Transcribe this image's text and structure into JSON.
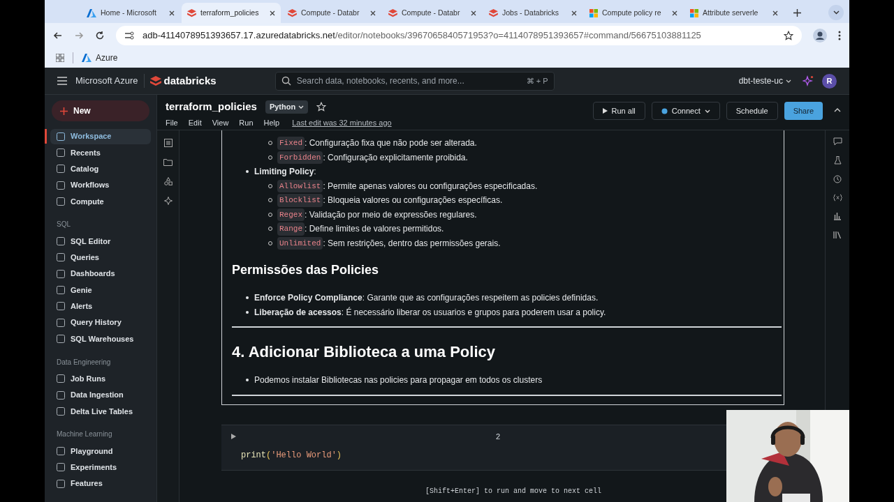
{
  "browser": {
    "tabs": [
      {
        "title": "Home - Microsoft",
        "selected": false
      },
      {
        "title": "terraform_policies",
        "selected": true
      },
      {
        "title": "Compute - Databr",
        "selected": false
      },
      {
        "title": "Compute - Databr",
        "selected": false
      },
      {
        "title": "Jobs - Databricks",
        "selected": false
      },
      {
        "title": "Compute policy re",
        "selected": false
      },
      {
        "title": "Attribute serverle",
        "selected": false
      }
    ],
    "url_host": "adb-4114078951393657.17.azuredatabricks.net",
    "url_path": "/editor/notebooks/3967065840571953?o=4114078951393657#command/56675103881125",
    "bookmarks": [
      "Azure"
    ]
  },
  "header": {
    "brand": "Microsoft Azure",
    "product": "databricks",
    "search_placeholder": "Search data, notebooks, recents, and more...",
    "shortcut": "⌘ + P",
    "workspace": "dbt-teste-uc",
    "avatar": "R"
  },
  "sidebar": {
    "new_label": "New",
    "sections": [
      {
        "items": [
          {
            "label": "Workspace",
            "selected": true
          },
          {
            "label": "Recents",
            "selected": false
          },
          {
            "label": "Catalog",
            "selected": false
          },
          {
            "label": "Workflows",
            "selected": false
          },
          {
            "label": "Compute",
            "selected": false
          }
        ]
      },
      {
        "title": "SQL",
        "items": [
          {
            "label": "SQL Editor",
            "selected": false
          },
          {
            "label": "Queries",
            "selected": false
          },
          {
            "label": "Dashboards",
            "selected": false
          },
          {
            "label": "Genie",
            "selected": false
          },
          {
            "label": "Alerts",
            "selected": false
          },
          {
            "label": "Query History",
            "selected": false
          },
          {
            "label": "SQL Warehouses",
            "selected": false
          }
        ]
      },
      {
        "title": "Data Engineering",
        "items": [
          {
            "label": "Job Runs",
            "selected": false
          },
          {
            "label": "Data Ingestion",
            "selected": false
          },
          {
            "label": "Delta Live Tables",
            "selected": false
          }
        ]
      },
      {
        "title": "Machine Learning",
        "items": [
          {
            "label": "Playground",
            "selected": false
          },
          {
            "label": "Experiments",
            "selected": false
          },
          {
            "label": "Features",
            "selected": false
          }
        ]
      }
    ]
  },
  "notebook": {
    "title": "terraform_policies",
    "language": "Python",
    "menus": [
      "File",
      "Edit",
      "View",
      "Run",
      "Help"
    ],
    "last_edit": "Last edit was 32 minutes ago",
    "buttons": [
      {
        "label": "Run all",
        "kind": "run"
      },
      {
        "label": "Connect",
        "kind": "connect"
      },
      {
        "label": "Schedule",
        "kind": "plain"
      },
      {
        "label": "Share",
        "kind": "primary"
      }
    ]
  },
  "markdown_cell": {
    "blocks": [
      {
        "kind": "subitem",
        "code": "Fixed",
        "text": ": Configuração fixa que não pode ser alterada."
      },
      {
        "kind": "subitem",
        "code": "Forbidden",
        "text": ": Configuração explicitamente proibida."
      },
      {
        "kind": "bullet",
        "text": "**Limiting Policy**:"
      },
      {
        "kind": "subitem",
        "code": "Allowlist",
        "text": ": Permite apenas valores ou configurações especificadas."
      },
      {
        "kind": "subitem",
        "code": "Blocklist",
        "text": ": Bloqueia valores ou configurações específicas."
      },
      {
        "kind": "subitem",
        "code": "Regex",
        "text": ": Validação por meio de expressões regulares."
      },
      {
        "kind": "subitem",
        "code": "Range",
        "text": ": Define limites de valores permitidos."
      },
      {
        "kind": "subitem",
        "code": "Unlimited",
        "text": ": Sem restrições, dentro das permissões gerais."
      },
      {
        "kind": "h2",
        "text": "Permissões das Policies"
      },
      {
        "kind": "bullet",
        "text": "**Enforce Policy Compliance**: Garante que as configurações respeitem as policies definidas."
      },
      {
        "kind": "bullet",
        "text": "**Liberação de acessos**: É necessário liberar os usuarios e grupos para poderem usar a policy."
      },
      {
        "kind": "rule"
      },
      {
        "kind": "h1",
        "text": "4. Adicionar Biblioteca a uma Policy"
      },
      {
        "kind": "bullet",
        "text": "Podemos instalar Bibliotecas nas policies para propagar em todos os clusters"
      },
      {
        "kind": "rule"
      }
    ]
  },
  "code_cell": {
    "number": "2",
    "tokens": [
      {
        "text": "print",
        "kind": "function"
      },
      {
        "text": "(",
        "kind": "bracket"
      },
      {
        "text": "'Hello World'",
        "kind": "string"
      },
      {
        "text": ")",
        "kind": "bracket"
      }
    ]
  },
  "hint": "[Shift+Enter] to run and move to next cell"
}
